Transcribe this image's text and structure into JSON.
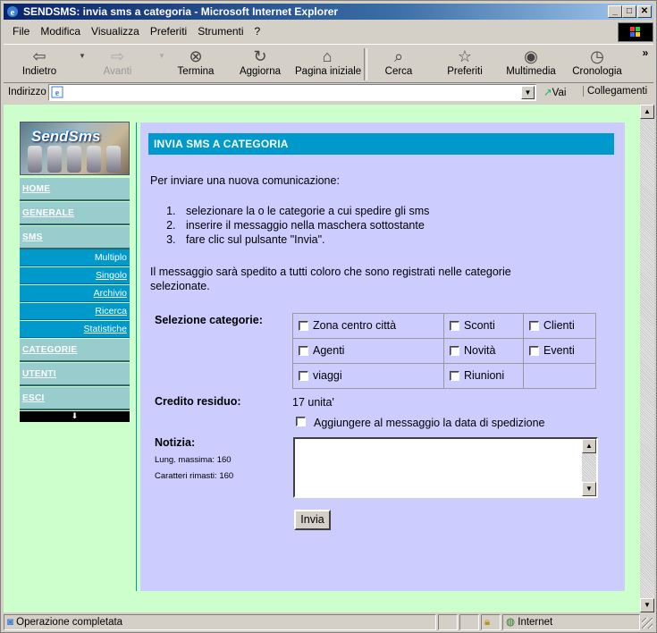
{
  "window": {
    "title": "SENDSMS: invia sms a categoria - Microsoft Internet Explorer"
  },
  "menu": [
    "File",
    "Modifica",
    "Visualizza",
    "Preferiti",
    "Strumenti",
    "?"
  ],
  "toolbar": {
    "back": "Indietro",
    "forward": "Avanti",
    "stop": "Termina",
    "refresh": "Aggiorna",
    "home": "Pagina iniziale",
    "search": "Cerca",
    "favorites": "Preferiti",
    "media": "Multimedia",
    "history": "Cronologia"
  },
  "address": {
    "label": "Indirizzo",
    "value": "",
    "go": "Vai",
    "links": "Collegamenti"
  },
  "site": {
    "logo_text": "SendSms"
  },
  "nav": {
    "home": "HOME",
    "generale": "GENERALE",
    "sms": "SMS",
    "sms_sub": [
      "Multiplo",
      "Singolo",
      "Archivio",
      "Ricerca",
      "Statistiche"
    ],
    "categorie": "CATEGORIE",
    "utenti": "UTENTI",
    "esci": "ESCI",
    "end_glyph": "⬇"
  },
  "main": {
    "header": "INVIA SMS A CATEGORIA",
    "intro": "Per inviare una nuova comunicazione:",
    "steps": [
      "selezionare la o le categorie a cui spedire gli sms",
      "inserire il messaggio nella maschera sottostante",
      "fare clic sul pulsante \"Invia\"."
    ],
    "note_line1": "Il messaggio sarà spedito a tutti coloro che sono registrati nelle categorie",
    "note_line2": "selezionate.",
    "categories_label": "Selezione categorie:",
    "categories": [
      [
        "Zona centro città",
        "Sconti",
        "Clienti"
      ],
      [
        "Agenti",
        "Novità",
        "Eventi"
      ],
      [
        "viaggi",
        "Riunioni",
        ""
      ]
    ],
    "credit_label": "Credito residuo:",
    "credit_value": "17 unita'",
    "add_date_label": "Aggiungere al messaggio la data di spedizione",
    "notice_label": "Notizia:",
    "max_length": "Lung. massima: 160",
    "remaining": "Caratteri rimasti: 160",
    "message_text": "",
    "send_button": "Invia"
  },
  "status": {
    "text": "Operazione completata",
    "zone": "Internet"
  }
}
